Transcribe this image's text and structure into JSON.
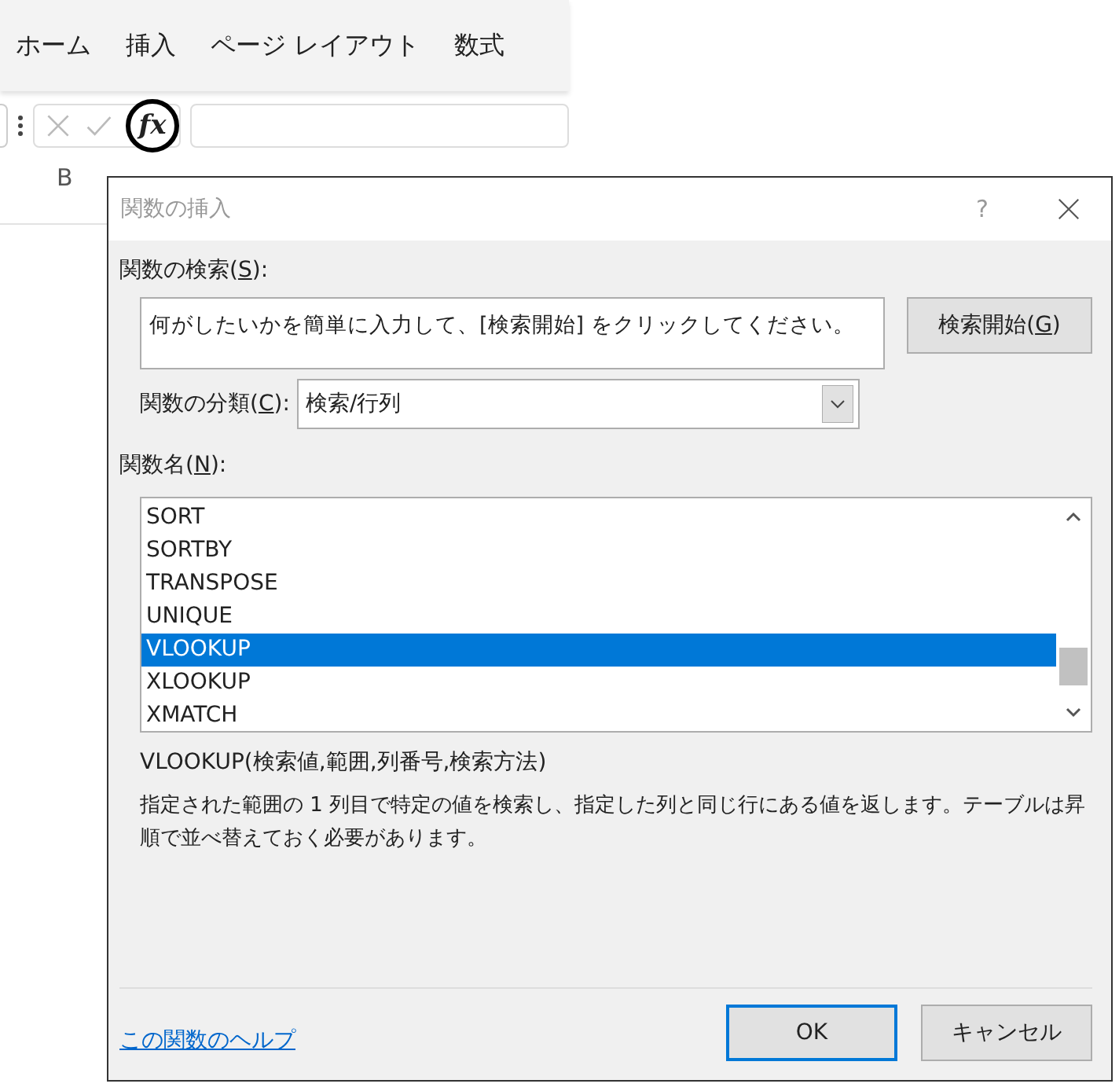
{
  "ribbon": {
    "tabs": [
      {
        "label": "ホーム"
      },
      {
        "label": "挿入"
      },
      {
        "label": "ページ レイアウト"
      },
      {
        "label": "数式"
      }
    ]
  },
  "formula_bar": {
    "function_button": "fx"
  },
  "sheet": {
    "column_headers": [
      "B"
    ]
  },
  "dialog": {
    "title": "関数の挿入",
    "help_button": "?",
    "search_label": {
      "before": "関数の検索(",
      "key": "S",
      "after": "):"
    },
    "search_field": {
      "value": "何がしたいかを簡単に入力して、[検索開始] をクリックしてください。"
    },
    "search_button": {
      "before": "検索開始(",
      "key": "G",
      "after": ")"
    },
    "category_label": {
      "before": "関数の分類(",
      "key": "C",
      "after": "):"
    },
    "category": {
      "value": "検索/行列"
    },
    "list_label": {
      "before": "関数名(",
      "key": "N",
      "after": "):"
    },
    "functions": [
      {
        "name": "SORT",
        "selected": false
      },
      {
        "name": "SORTBY",
        "selected": false
      },
      {
        "name": "TRANSPOSE",
        "selected": false
      },
      {
        "name": "UNIQUE",
        "selected": false
      },
      {
        "name": "VLOOKUP",
        "selected": true
      },
      {
        "name": "XLOOKUP",
        "selected": false
      },
      {
        "name": "XMATCH",
        "selected": false
      }
    ],
    "syntax": "VLOOKUP(検索値,範囲,列番号,検索方法)",
    "description": "指定された範囲の 1 列目で特定の値を検索し、指定した列と同じ行にある値を返します。テーブルは昇順で並べ替えておく必要があります。",
    "help_link": "この関数のヘルプ",
    "buttons": [
      {
        "label": "OK",
        "kind": "default"
      },
      {
        "label": "キャンセル",
        "kind": "normal"
      }
    ]
  }
}
